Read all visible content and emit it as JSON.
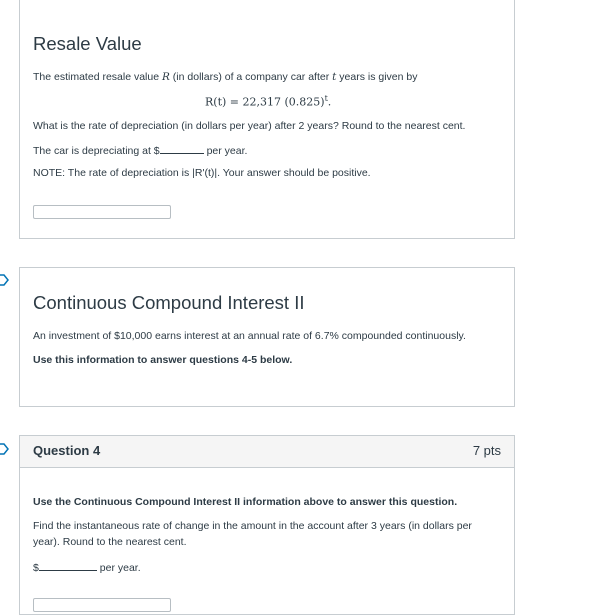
{
  "q_resale": {
    "title": "Resale Value",
    "intro_a": "The estimated resale value ",
    "intro_var_r": "R",
    "intro_b": " (in dollars) of a company car after ",
    "intro_var_t": "t",
    "intro_c": " years is given by",
    "equation_lhs": "R(t) = ",
    "equation_rhs": "22,317 (0.825)",
    "equation_exp": "t",
    "equation_end": ".",
    "question": "What is the rate of depreciation (in dollars per year) after 2 years?  Round to the nearest cent.",
    "answer_prefix": "The car is depreciating at $",
    "answer_suffix": " per year.",
    "note": "NOTE: The rate of depreciation is |R'(t)|. Your answer should be positive."
  },
  "info_cci": {
    "title": "Continuous Compound Interest II",
    "text": "An investment of $10,000 earns interest at an annual rate of 6.7% compounded continuously.",
    "instruction": "Use this information to answer questions 4-5 below."
  },
  "question4": {
    "title": "Question 4",
    "points": "7 pts",
    "instruction": "Use the Continuous Compound Interest II information above to answer this question.",
    "text_line1": "Find the instantaneous rate of change in the amount in the account after 3 years (in dollars per",
    "text_line2": "year).  Round to the nearest cent.",
    "answer_prefix": "$",
    "answer_suffix": " per year."
  },
  "colors": {
    "text": "#2d3b45",
    "border": "#c7cdd1",
    "header_bg": "#f5f5f5",
    "flag": "#0374b5"
  }
}
